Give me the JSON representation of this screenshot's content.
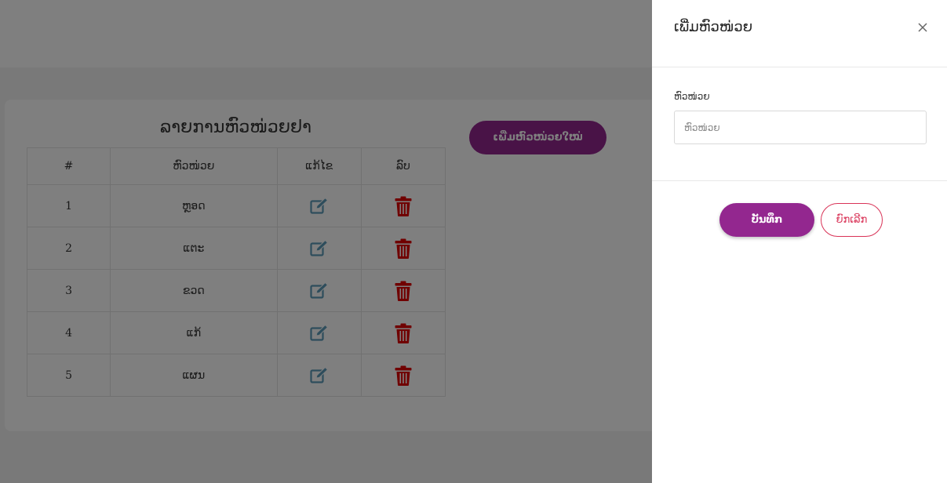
{
  "page": {
    "title": "ລາຍການຫົວໜ່ວຍຢາ",
    "add_button": "ເພີ່ມຫົວໜ່ວຍໃໝ່"
  },
  "table": {
    "columns": [
      "#",
      "ຫົວໜ່ວຍ",
      "ແກ້ໄຂ",
      "ລົບ"
    ],
    "rows": [
      {
        "num": "1",
        "unit": "ຫຼອດ"
      },
      {
        "num": "2",
        "unit": "ແຕະ"
      },
      {
        "num": "3",
        "unit": "ຂວດ"
      },
      {
        "num": "4",
        "unit": "ແກ້"
      },
      {
        "num": "5",
        "unit": "ແຜນ"
      }
    ]
  },
  "drawer": {
    "title": "ເພີ່ມຫົວໜ່ວຍ",
    "field_label": "ຫົວໜ່ວຍ",
    "field_placeholder": "ຫົວໜ່ວຍ",
    "save_label": "ບັນທຶກ",
    "cancel_label": "ຍົກເລີກ"
  },
  "colors": {
    "primary": "#93278f",
    "danger": "#e00000",
    "edit_icon": "#5c9bb8",
    "cancel": "#d93357"
  },
  "icons": {
    "edit": "edit-icon",
    "delete": "trash-icon",
    "close": "close-icon"
  }
}
